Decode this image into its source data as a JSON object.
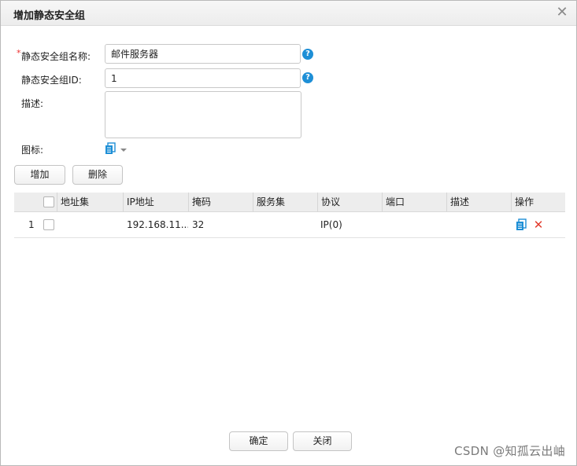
{
  "dialog": {
    "title": "增加静态安全组",
    "close_icon": "close-icon"
  },
  "form": {
    "name_label": "静态安全组名称:",
    "name_required": "*",
    "name_value": "邮件服务器",
    "id_label": "静态安全组ID:",
    "id_value": "1",
    "desc_label": "描述:",
    "desc_value": "",
    "icon_label": "图标:",
    "help_glyph": "?"
  },
  "toolbar": {
    "add_label": "增加",
    "delete_label": "删除"
  },
  "table": {
    "columns": [
      "地址集",
      "IP地址",
      "掩码",
      "服务集",
      "协议",
      "端口",
      "描述",
      "操作"
    ],
    "rows": [
      {
        "index": "1",
        "address_set": "",
        "ip": "192.168.11...",
        "mask": "32",
        "service_set": "",
        "protocol": "IP(0)",
        "port": "",
        "description": ""
      }
    ]
  },
  "footer": {
    "ok_label": "确定",
    "close_label": "关闭"
  },
  "watermark": "CSDN @知孤云出岫",
  "colors": {
    "accent_blue": "#1e8fd6",
    "delete_red": "#e23b2e"
  }
}
